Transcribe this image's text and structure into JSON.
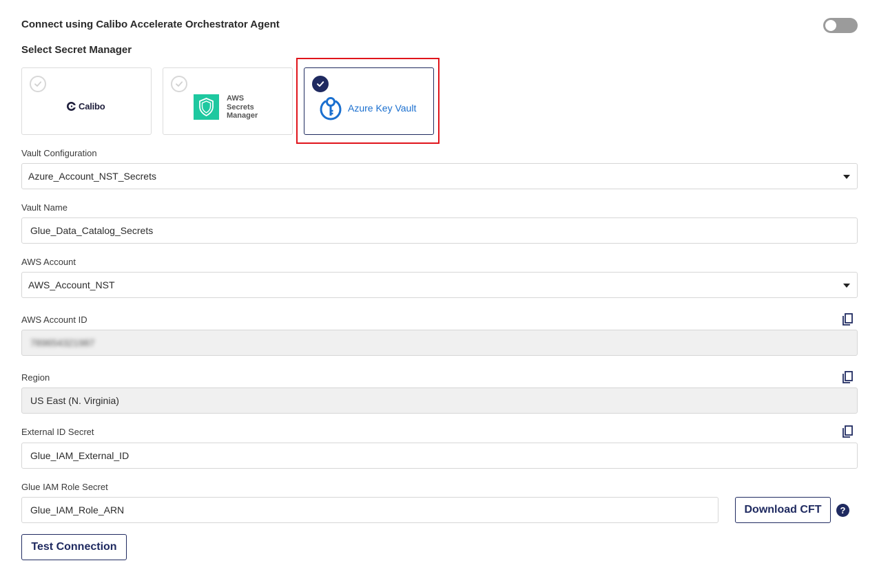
{
  "agent": {
    "label": "Connect using Calibo Accelerate Orchestrator Agent",
    "enabled": false
  },
  "secret_manager": {
    "title": "Select Secret Manager",
    "options": [
      {
        "name": "Calibo",
        "selected": false
      },
      {
        "name_lines": [
          "AWS",
          "Secrets",
          "Manager"
        ],
        "selected": false
      },
      {
        "name": "Azure Key Vault",
        "selected": true
      }
    ]
  },
  "fields": {
    "vault_configuration": {
      "label": "Vault Configuration",
      "value": "Azure_Account_NST_Secrets"
    },
    "vault_name": {
      "label": "Vault Name",
      "value": "Glue_Data_Catalog_Secrets"
    },
    "aws_account": {
      "label": "AWS Account",
      "value": "AWS_Account_NST"
    },
    "aws_account_id": {
      "label": "AWS Account ID",
      "value": "789654321987"
    },
    "region": {
      "label": "Region",
      "value": "US East (N. Virginia)"
    },
    "external_id_secret": {
      "label": "External ID Secret",
      "value": "Glue_IAM_External_ID"
    },
    "glue_iam_role_secret": {
      "label": "Glue IAM Role Secret",
      "value": "Glue_IAM_Role_ARN"
    }
  },
  "buttons": {
    "download_cft": "Download CFT",
    "test_connection": "Test Connection",
    "help": "?"
  },
  "colors": {
    "primary": "#1f2a60",
    "highlight": "#e0141b",
    "azure_blue": "#1a6fcf",
    "aws_green": "#1ec8a0"
  },
  "icons": {
    "copy": "copy-icon",
    "check": "check-icon",
    "help": "help-icon",
    "dropdown": "chevron-down-icon"
  }
}
